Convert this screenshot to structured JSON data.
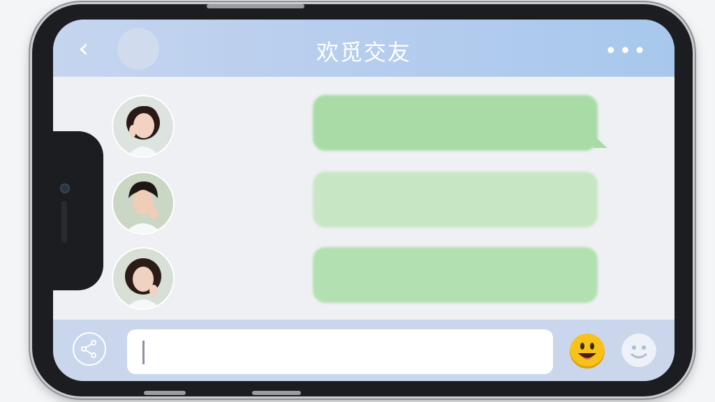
{
  "header": {
    "title": "欢觅交友",
    "back_icon": "chevron-left-icon",
    "more_icon": "more-dots-icon",
    "back_glyph": "‹",
    "more_glyph": "•••"
  },
  "messages": [
    {
      "sender": "female-user-1",
      "text": ""
    },
    {
      "sender": "male-user",
      "text": ""
    },
    {
      "sender": "female-user-2",
      "text": ""
    }
  ],
  "input_bar": {
    "share_icon": "share-icon",
    "input_value": "",
    "emoji_icon": "grinning-emoji-icon",
    "smiley_icon": "smiley-face-icon"
  },
  "colors": {
    "header_gradient_start": "#c5d5ef",
    "header_gradient_end": "#a7c8ec",
    "bubble": "#a9dba7",
    "bar": "#c9d6ec"
  }
}
